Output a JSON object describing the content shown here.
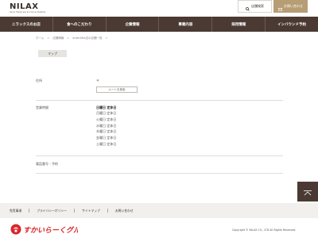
{
  "header": {
    "logo_text": "NILAX",
    "logo_tagline": "Serve Happiness and Grow Together",
    "search_label": "店舗検索",
    "contact_label": "お問い合わせ"
  },
  "nav": {
    "items": [
      {
        "label": "ニラックスのお店"
      },
      {
        "label": "食へのこだわり"
      },
      {
        "label": "企業情報"
      },
      {
        "label": "事業内容"
      },
      {
        "label": "採用情報"
      },
      {
        "label": "インバウンド予約"
      }
    ]
  },
  "breadcrumb": {
    "items": [
      "ホーム",
      "店舗情報",
      "ordertitle店の店舗一覧"
    ],
    "separator": ">"
  },
  "map_tab": {
    "label": "マップ"
  },
  "info": {
    "address_label": "住所",
    "postal_mark": "〒",
    "route_button": "ルートを検索",
    "hours_label": "営業時間",
    "hours_head": "日曜日 定休日",
    "hours_lines": [
      "月曜日 定休日",
      "火曜日 定休日",
      "水曜日 定休日",
      "木曜日 定休日",
      "金曜日 定休日",
      "土曜日 定休日"
    ],
    "phone_label": "電話番号・予約"
  },
  "footer": {
    "links": [
      "免責事項",
      "プライバシーポリシー",
      "サイトマップ",
      "お問い合わせ"
    ],
    "brand_text": "すかいらーくグループ",
    "copyright": "Copyright © NILAX CO., LTD All Rights Reserved."
  },
  "colors": {
    "nav_bg": "#4a3a33",
    "accent": "#b79d74",
    "brand_red": "#d9252b"
  }
}
